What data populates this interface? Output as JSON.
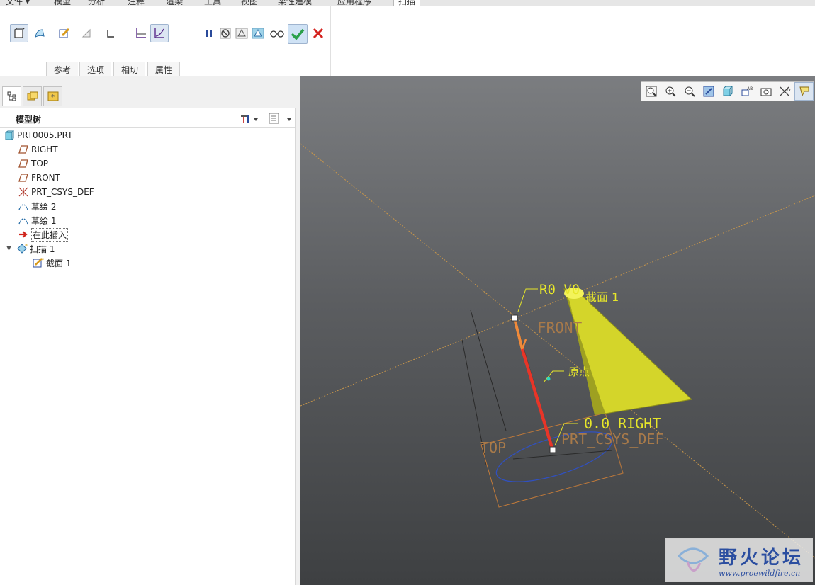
{
  "menu": {
    "tabs": [
      "文件 ▾",
      "模型",
      "分析",
      "注释",
      "渲染",
      "工具",
      "视图",
      "柔性建模",
      "应用程序",
      "扫描"
    ],
    "active": "扫描"
  },
  "ribbon": {
    "subtabs": [
      "参考",
      "选项",
      "相切",
      "属性"
    ]
  },
  "panel": {
    "tree_title": "模型树"
  },
  "tree": {
    "items": [
      {
        "label": "PRT0005.PRT",
        "icon": "part-icon"
      },
      {
        "label": "RIGHT",
        "icon": "datum-plane-icon"
      },
      {
        "label": "TOP",
        "icon": "datum-plane-icon"
      },
      {
        "label": "FRONT",
        "icon": "datum-plane-icon"
      },
      {
        "label": "PRT_CSYS_DEF",
        "icon": "csys-icon"
      },
      {
        "label": "草绘 2",
        "icon": "sketch-icon"
      },
      {
        "label": "草绘 1",
        "icon": "sketch-icon"
      },
      {
        "label": "在此插入",
        "icon": "insert-arrow-icon"
      },
      {
        "label": "扫描 1",
        "icon": "sweep-icon"
      },
      {
        "label": "截面 1",
        "icon": "section-icon"
      }
    ]
  },
  "viewport": {
    "labels": {
      "front": "FRONT",
      "top": "TOP",
      "origin": "原点",
      "section": "截面 1",
      "r0": "R0 V0",
      "right": "0.0 RIGHT",
      "csys": "PRT_CSYS_DEF"
    }
  },
  "watermark": {
    "text": "野火论坛",
    "url": "www.proewildfire.cn"
  },
  "colors": {
    "sweep_surface": "#d4d52a",
    "trajectory": "#e83528",
    "datum": "#c8964a",
    "accept": "#2aa04a",
    "cancel": "#d4231f"
  }
}
